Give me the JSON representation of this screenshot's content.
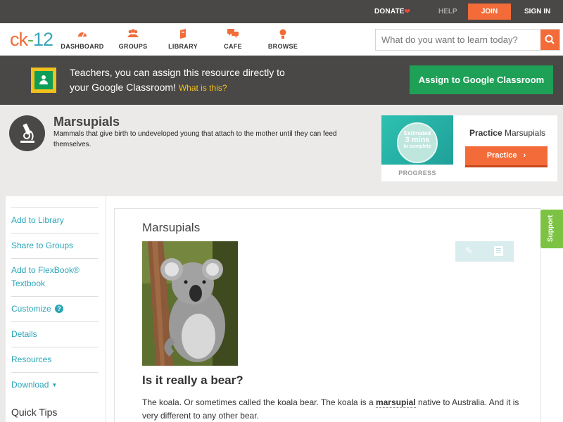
{
  "topbar": {
    "donate": "DONATE",
    "help": "HELP",
    "join": "JOIN",
    "sign_in": "SIGN IN"
  },
  "logo": {
    "ck": "ck",
    "dash": "-",
    "twelve": "12"
  },
  "nav": [
    {
      "label": "DASHBOARD",
      "icon": "dashboard-icon"
    },
    {
      "label": "GROUPS",
      "icon": "groups-icon"
    },
    {
      "label": "LIBRARY",
      "icon": "library-icon"
    },
    {
      "label": "CAFE",
      "icon": "cafe-icon"
    },
    {
      "label": "BROWSE",
      "icon": "browse-icon"
    }
  ],
  "search": {
    "placeholder": "What do you want to learn today?"
  },
  "classroom_banner": {
    "line1": "Teachers, you can assign this resource directly to",
    "line2": "your Google Classroom!",
    "what_link": "What is this?",
    "button": "Assign to Google Classroom"
  },
  "concept": {
    "title": "Marsupials",
    "description": "Mammals that give birth to undeveloped young that attach to the mother until they can feed themselves."
  },
  "progress_card": {
    "estimated_line1": "Estimated",
    "estimated_line2": "3 mins",
    "estimated_line3": "to complete",
    "progress_label": "PROGRESS",
    "practice_bold": "Practice",
    "practice_topic": "Marsupials",
    "practice_button": "Practice"
  },
  "sidebar": {
    "items": [
      {
        "label": "Add to Library"
      },
      {
        "label": "Share to Groups"
      },
      {
        "label": "Add to FlexBook®",
        "label2": "Textbook"
      },
      {
        "label": "Customize"
      },
      {
        "label": "Details"
      },
      {
        "label": "Resources"
      },
      {
        "label": "Download"
      }
    ],
    "quick_tips": "Quick Tips"
  },
  "main": {
    "title": "Marsupials",
    "heading": "Is it really a bear?",
    "para_before": "The koala. Or sometimes called the koala bear. The koala is a ",
    "para_keyword": "marsupial",
    "para_after": " native to Australia. And it is very different to any other bear."
  },
  "support_tab": "Support",
  "colors": {
    "accent_orange": "#f26b38",
    "teal_link": "#2aa5b8",
    "google_green": "#1fa057",
    "dark_bar": "#4a4846",
    "support_green": "#7dc343"
  }
}
